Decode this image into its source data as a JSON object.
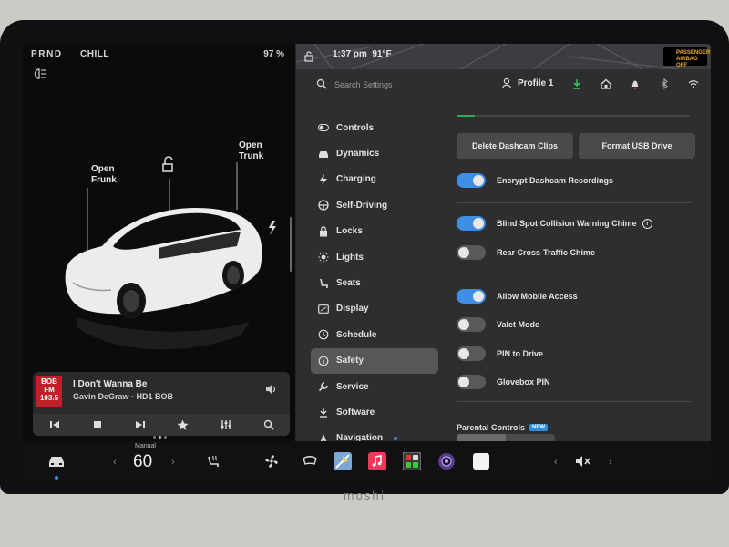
{
  "status": {
    "gears": "PRND",
    "drive_mode": "CHILL",
    "battery": "97 %",
    "time": "1:37 pm",
    "temperature": "91°F",
    "airbag_line1": "PASSENGER",
    "airbag_line2": "AIRBAG OFF"
  },
  "car": {
    "open_frunk": "Open\nFrunk",
    "open_trunk": "Open\nTrunk"
  },
  "media": {
    "logo_line1": "BOB",
    "logo_line2": "FM",
    "logo_line3": "103.5",
    "title": "I Don't Wanna Be",
    "subtitle": "Gavin DeGraw · HD1 BOB"
  },
  "settings": {
    "search_placeholder": "Search Settings",
    "profile": "Profile 1",
    "nav": [
      {
        "label": "Controls",
        "icon": "toggle-icon"
      },
      {
        "label": "Dynamics",
        "icon": "car-icon"
      },
      {
        "label": "Charging",
        "icon": "bolt-icon"
      },
      {
        "label": "Self-Driving",
        "icon": "steering-wheel-icon"
      },
      {
        "label": "Locks",
        "icon": "lock-icon"
      },
      {
        "label": "Lights",
        "icon": "sun-icon"
      },
      {
        "label": "Seats",
        "icon": "seat-icon"
      },
      {
        "label": "Display",
        "icon": "display-icon"
      },
      {
        "label": "Schedule",
        "icon": "clock-icon"
      },
      {
        "label": "Safety",
        "icon": "info-circle-icon"
      },
      {
        "label": "Service",
        "icon": "wrench-icon"
      },
      {
        "label": "Software",
        "icon": "download-icon"
      },
      {
        "label": "Navigation",
        "icon": "navigation-icon"
      }
    ],
    "active_nav": "Safety",
    "buttons": {
      "delete_dashcam": "Delete Dashcam Clips",
      "format_usb": "Format USB Drive"
    },
    "toggles": [
      {
        "label": "Encrypt Dashcam Recordings",
        "on": true
      },
      {
        "label": "Blind Spot Collision Warning Chime",
        "on": true
      },
      {
        "label": "Rear Cross-Traffic Chime",
        "on": false
      },
      {
        "label": "Allow Mobile Access",
        "on": true
      },
      {
        "label": "Valet Mode",
        "on": false
      },
      {
        "label": "PIN to Drive",
        "on": false
      },
      {
        "label": "Glovebox PIN",
        "on": false
      }
    ],
    "parental_controls": "Parental Controls",
    "new_badge": "NEW"
  },
  "dock": {
    "speed_label": "Manual",
    "speed": "60"
  },
  "colors": {
    "accent": "#3e8ee6",
    "background": "#2e2e30",
    "active_nav": "#575759"
  }
}
